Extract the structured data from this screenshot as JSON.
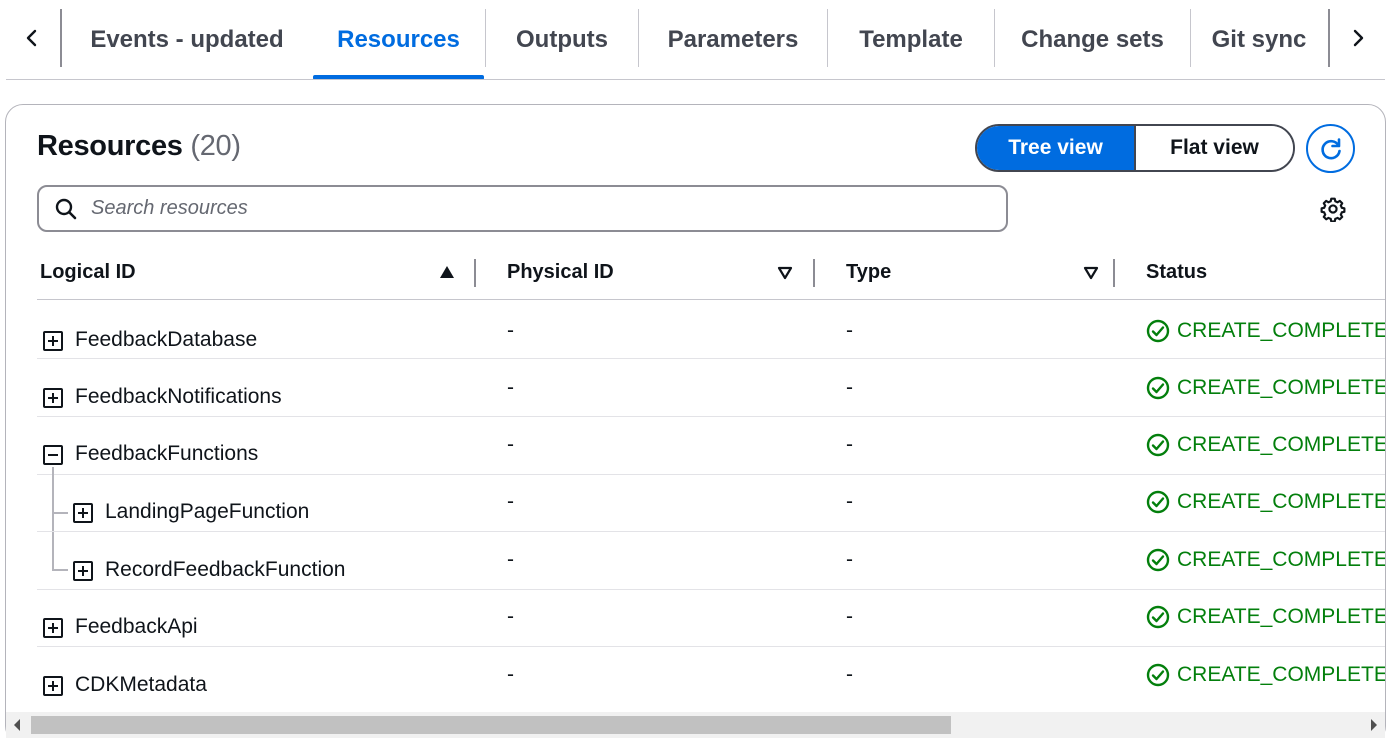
{
  "tabs": [
    {
      "label": "Events - updated",
      "active": false
    },
    {
      "label": "Resources",
      "active": true
    },
    {
      "label": "Outputs",
      "active": false
    },
    {
      "label": "Parameters",
      "active": false
    },
    {
      "label": "Template",
      "active": false
    },
    {
      "label": "Change sets",
      "active": false
    },
    {
      "label": "Git sync",
      "active": false
    }
  ],
  "header": {
    "title": "Resources",
    "count": "(20)"
  },
  "view_toggle": {
    "tree_label": "Tree view",
    "flat_label": "Flat view",
    "selected": "Tree view"
  },
  "search": {
    "placeholder": "Search resources",
    "value": ""
  },
  "table": {
    "columns": [
      "Logical ID",
      "Physical ID",
      "Type",
      "Status"
    ],
    "sort_column": "Logical ID",
    "sort_direction": "ascending",
    "rows": [
      {
        "logical_id": "FeedbackDatabase",
        "physical_id": "-",
        "type": "-",
        "status": "CREATE_COMPLETE",
        "expanded": false,
        "depth": 0
      },
      {
        "logical_id": "FeedbackNotifications",
        "physical_id": "-",
        "type": "-",
        "status": "CREATE_COMPLETE",
        "expanded": false,
        "depth": 0
      },
      {
        "logical_id": "FeedbackFunctions",
        "physical_id": "-",
        "type": "-",
        "status": "CREATE_COMPLETE",
        "expanded": true,
        "depth": 0
      },
      {
        "logical_id": "LandingPageFunction",
        "physical_id": "-",
        "type": "-",
        "status": "CREATE_COMPLETE",
        "expanded": false,
        "depth": 1
      },
      {
        "logical_id": "RecordFeedbackFunction",
        "physical_id": "-",
        "type": "-",
        "status": "CREATE_COMPLETE",
        "expanded": false,
        "depth": 1
      },
      {
        "logical_id": "FeedbackApi",
        "physical_id": "-",
        "type": "-",
        "status": "CREATE_COMPLETE",
        "expanded": false,
        "depth": 0
      },
      {
        "logical_id": "CDKMetadata",
        "physical_id": "-",
        "type": "-",
        "status": "CREATE_COMPLETE",
        "expanded": false,
        "depth": 0
      }
    ]
  },
  "colors": {
    "accent": "#006ce0",
    "success": "#037f0c",
    "text": "#0f141a",
    "muted": "#656871"
  },
  "icons": [
    "chevron-left-icon",
    "chevron-right-icon",
    "refresh-icon",
    "search-icon",
    "settings-icon",
    "sort-ascending-icon",
    "sort-descending-icon",
    "expand-icon",
    "collapse-icon",
    "status-success-icon"
  ]
}
